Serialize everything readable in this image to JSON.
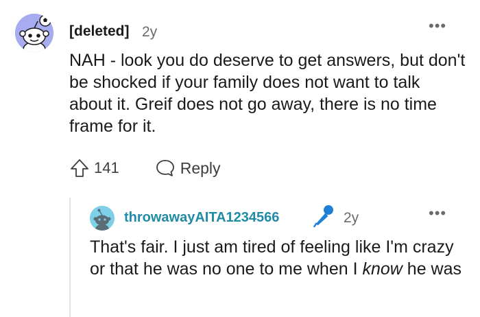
{
  "comment": {
    "author": "[deleted]",
    "time": "2y",
    "more": "•••",
    "body": "NAH - look you do deserve to get answers, but don't be shocked if your family does not want to talk about it. Greif does not go away, there is no time frame for it.",
    "upvotes": "141",
    "reply_label": "Reply"
  },
  "reply": {
    "author": "throwawayAITA1234566",
    "author_color": "#1f8ba6",
    "flair_icon": "microphone-icon",
    "time": "2y",
    "more": "•••",
    "body_before": "That's fair. I just am tired of feeling like I'm crazy or that he was no one to me when I ",
    "body_emphasis": "know",
    "body_after": " he was"
  },
  "colors": {
    "avatar_main_bg": "#a7acf0",
    "avatar_reply_bg": "#7dd0e8",
    "mic": "#1f7fd6"
  }
}
